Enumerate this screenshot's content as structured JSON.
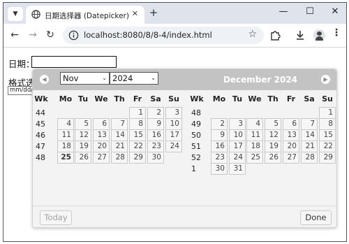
{
  "browser": {
    "tab_title": "日期选择器 (Datepicker)",
    "url": "localhost:8080/8/8-4/index.html",
    "icons": {
      "tab_menu": "chevron-down-icon",
      "favicon": "globe-icon",
      "close": "close-icon",
      "new_tab": "plus-icon",
      "minimize": "minimize-icon",
      "maximize": "maximize-icon",
      "close_window": "close-window-icon",
      "back": "back-arrow-icon",
      "forward": "forward-arrow-icon",
      "reload": "reload-icon",
      "site_info": "site-info-icon",
      "bookmark": "star-icon",
      "extensions": "puzzle-icon",
      "download": "download-icon",
      "profile": "avatar-icon",
      "menu": "kebab-menu-icon"
    }
  },
  "form": {
    "date_label": "日期：",
    "date_value": "",
    "format_label": "格式选",
    "format_value": "mm/dd/"
  },
  "datepicker": {
    "colors": {
      "header_bg": "#c3c3c3",
      "cell_bg": "#f6f6f6",
      "panel_bg": "#f3f3f3"
    },
    "prev_label": "Prev",
    "next_label": "Next",
    "months": [
      {
        "month_select": "Nov",
        "year_select": "2024",
        "headers": [
          "Wk",
          "Mo",
          "Tu",
          "We",
          "Th",
          "Fr",
          "Sa",
          "Su"
        ],
        "weeks": [
          {
            "wk": "44",
            "days": [
              "",
              "",
              "",
              "",
              "1",
              "2",
              "3"
            ]
          },
          {
            "wk": "45",
            "days": [
              "4",
              "5",
              "6",
              "7",
              "8",
              "9",
              "10"
            ]
          },
          {
            "wk": "46",
            "days": [
              "11",
              "12",
              "13",
              "14",
              "15",
              "16",
              "17"
            ]
          },
          {
            "wk": "47",
            "days": [
              "18",
              "19",
              "20",
              "21",
              "22",
              "23",
              "24"
            ]
          },
          {
            "wk": "48",
            "days": [
              "25",
              "26",
              "27",
              "28",
              "29",
              "30",
              ""
            ]
          }
        ],
        "today": "25"
      },
      {
        "title": "December 2024",
        "headers": [
          "Wk",
          "Mo",
          "Tu",
          "We",
          "Th",
          "Fr",
          "Sa",
          "Su"
        ],
        "weeks": [
          {
            "wk": "48",
            "days": [
              "",
              "",
              "",
              "",
              "",
              "",
              "1"
            ]
          },
          {
            "wk": "49",
            "days": [
              "2",
              "3",
              "4",
              "5",
              "6",
              "7",
              "8"
            ]
          },
          {
            "wk": "50",
            "days": [
              "9",
              "10",
              "11",
              "12",
              "13",
              "14",
              "15"
            ]
          },
          {
            "wk": "51",
            "days": [
              "16",
              "17",
              "18",
              "19",
              "20",
              "21",
              "22"
            ]
          },
          {
            "wk": "52",
            "days": [
              "23",
              "24",
              "25",
              "26",
              "27",
              "28",
              "29"
            ]
          },
          {
            "wk": "1",
            "days": [
              "30",
              "31",
              "",
              "",
              "",
              "",
              ""
            ]
          }
        ]
      }
    ],
    "today_button": "Today",
    "done_button": "Done"
  }
}
